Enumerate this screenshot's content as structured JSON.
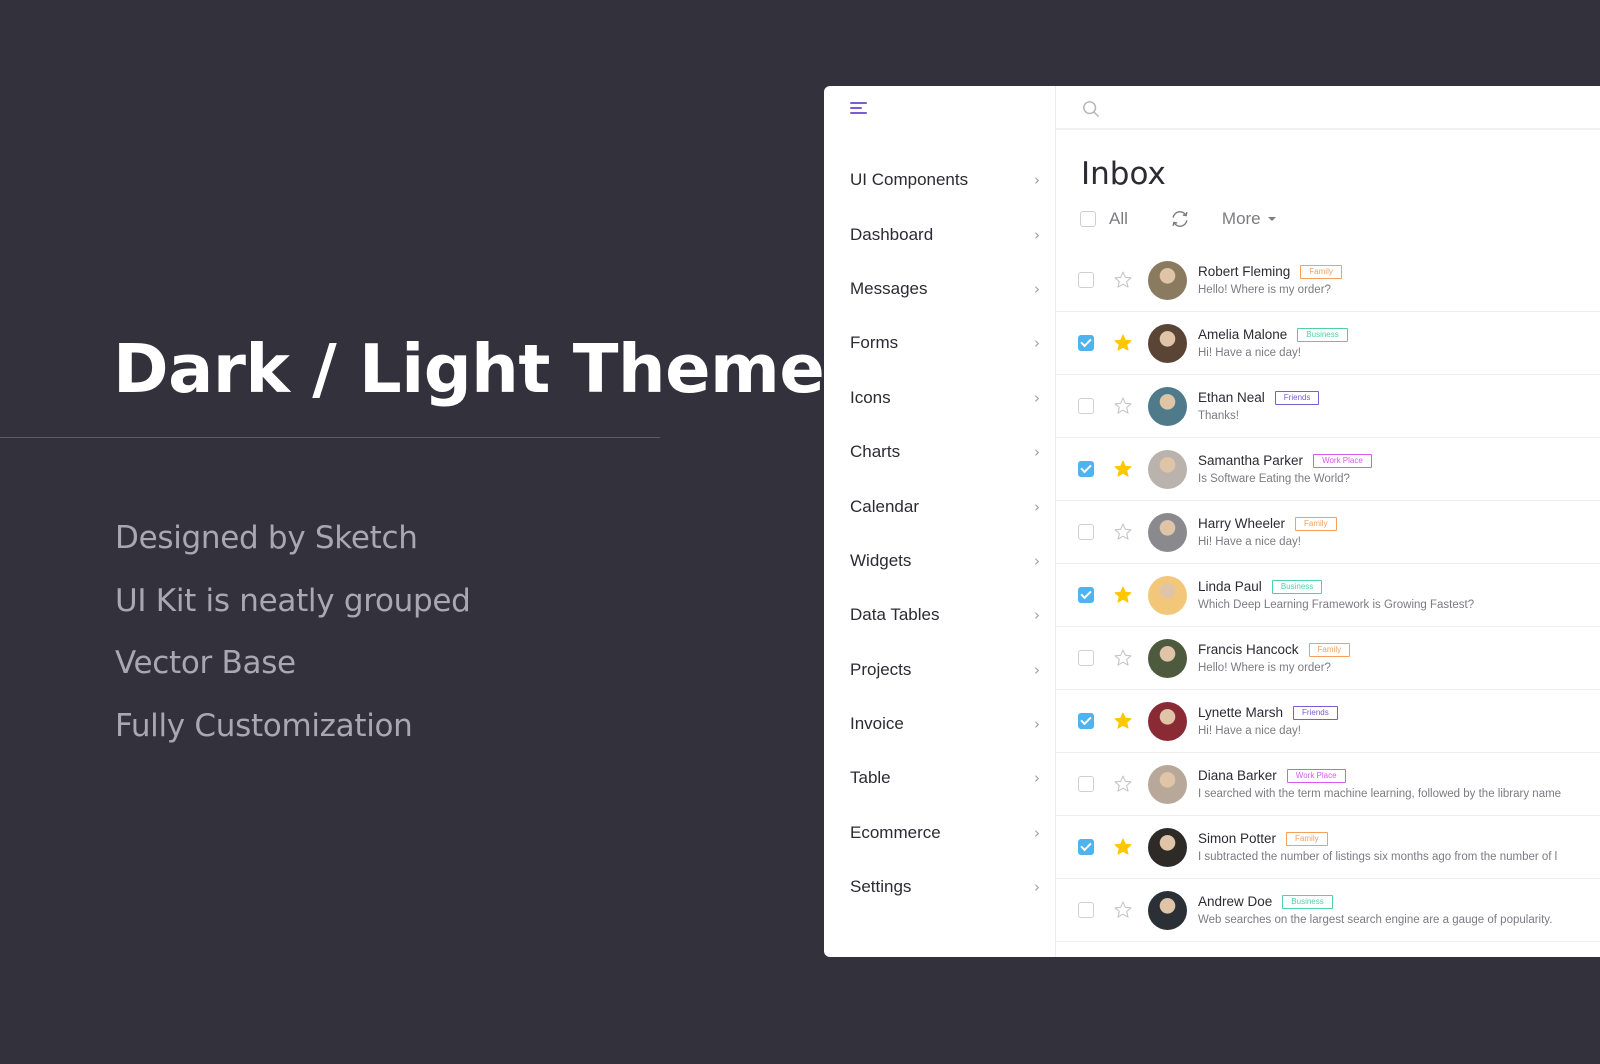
{
  "hero": {
    "title": "Dark / Light Theme",
    "features": [
      "Designed by Sketch",
      "UI Kit is neatly grouped",
      "Vector Base",
      "Fully Customization"
    ]
  },
  "colors": {
    "background": "#33313b",
    "accent": "#7c5bd6",
    "checkbox_checked": "#4fb3f0",
    "star_active": "#ffc700",
    "tag_family": "#f5a05c",
    "tag_business": "#4fd1a3",
    "tag_friends": "#7c5bd6",
    "tag_workplace": "#d65bf0"
  },
  "sidebar": {
    "items": [
      {
        "label": "UI Components"
      },
      {
        "label": "Dashboard"
      },
      {
        "label": "Messages"
      },
      {
        "label": "Forms"
      },
      {
        "label": "Icons"
      },
      {
        "label": "Charts"
      },
      {
        "label": "Calendar"
      },
      {
        "label": "Widgets"
      },
      {
        "label": "Data Tables"
      },
      {
        "label": "Projects"
      },
      {
        "label": "Invoice"
      },
      {
        "label": "Table"
      },
      {
        "label": "Ecommerce"
      },
      {
        "label": "Settings"
      }
    ]
  },
  "inbox": {
    "title": "Inbox",
    "all_label": "All",
    "more_label": "More",
    "messages": [
      {
        "name": "Robert Fleming",
        "tag": "Family",
        "tag_type": "family",
        "text": "Hello! Where is my order?",
        "checked": false,
        "starred": false,
        "avatar_color": "#8a7a60"
      },
      {
        "name": "Amelia Malone",
        "tag": "Business",
        "tag_type": "business",
        "text": "Hi! Have a nice day!",
        "checked": true,
        "starred": true,
        "avatar_color": "#5a4435"
      },
      {
        "name": "Ethan Neal",
        "tag": "Friends",
        "tag_type": "friends",
        "text": "Thanks!",
        "checked": false,
        "starred": false,
        "avatar_color": "#4f7a8a"
      },
      {
        "name": "Samantha Parker",
        "tag": "Work Place",
        "tag_type": "workplace",
        "text": "Is Software Eating the World?",
        "checked": true,
        "starred": true,
        "avatar_color": "#b9b2ad"
      },
      {
        "name": "Harry Wheeler",
        "tag": "Family",
        "tag_type": "family",
        "text": "Hi! Have a nice day!",
        "checked": false,
        "starred": false,
        "avatar_color": "#8a8a8e"
      },
      {
        "name": "Linda Paul",
        "tag": "Business",
        "tag_type": "business",
        "text": "Which Deep Learning Framework is Growing Fastest?",
        "checked": true,
        "starred": true,
        "avatar_color": "#f3c77a"
      },
      {
        "name": "Francis Hancock",
        "tag": "Family",
        "tag_type": "family",
        "text": "Hello! Where is my order?",
        "checked": false,
        "starred": false,
        "avatar_color": "#4e5a3e"
      },
      {
        "name": "Lynette Marsh",
        "tag": "Friends",
        "tag_type": "friends",
        "text": "Hi! Have a nice day!",
        "checked": true,
        "starred": true,
        "avatar_color": "#8a2a35"
      },
      {
        "name": "Diana Barker",
        "tag": "Work Place",
        "tag_type": "workplace",
        "text": "I searched with the term machine learning, followed by the library name",
        "checked": false,
        "starred": false,
        "avatar_color": "#b8a89a"
      },
      {
        "name": "Simon Potter",
        "tag": "Family",
        "tag_type": "family",
        "text": "I subtracted the number of listings six months ago from the number of l",
        "checked": true,
        "starred": true,
        "avatar_color": "#2e2a28"
      },
      {
        "name": "Andrew Doe",
        "tag": "Business",
        "tag_type": "business",
        "text": "Web searches on the largest search engine are a gauge of popularity.",
        "checked": false,
        "starred": false,
        "avatar_color": "#2a3036"
      }
    ]
  }
}
